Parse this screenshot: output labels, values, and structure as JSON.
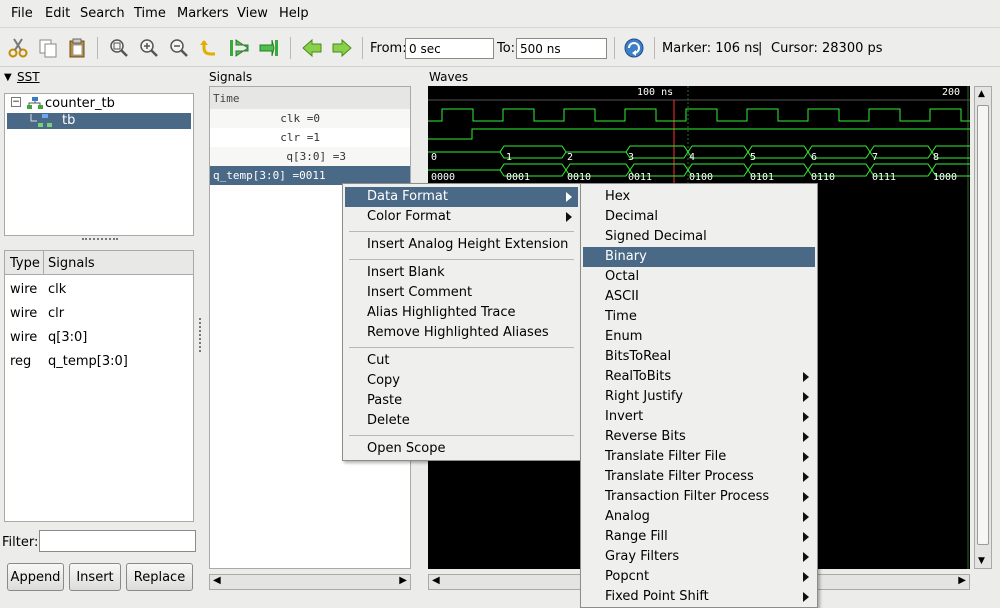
{
  "menu": [
    "File",
    "Edit",
    "Search",
    "Time",
    "Markers",
    "View",
    "Help"
  ],
  "toolbar": {
    "from_label": "From:",
    "from_value": "0 sec",
    "to_label": "To:",
    "to_value": "500 ns",
    "marker_text": "Marker: 106 ns",
    "separator": "|",
    "cursor_text": "Cursor: 28300 ps"
  },
  "sst": {
    "title": "SST",
    "tree": [
      "counter_tb",
      "tb"
    ],
    "columns": [
      "Type",
      "Signals"
    ],
    "rows": [
      {
        "type": "wire",
        "name": "clk"
      },
      {
        "type": "wire",
        "name": "clr"
      },
      {
        "type": "wire",
        "name": "q[3:0]"
      },
      {
        "type": "reg",
        "name": "q_temp[3:0]"
      }
    ],
    "filter_label": "Filter:",
    "filter_value": "",
    "buttons": [
      "Append",
      "Insert",
      "Replace"
    ]
  },
  "signals": {
    "title": "Signals",
    "header": "Time",
    "rows": [
      "clk =0",
      "clr =1",
      "q[3:0] =3",
      "q_temp[3:0] =0011"
    ]
  },
  "waves": {
    "title": "Waves",
    "ruler": [
      "100 ns",
      "200"
    ],
    "q_values": [
      "0",
      "1",
      "2",
      "3",
      "4",
      "5",
      "6",
      "7",
      "8"
    ],
    "qtemp_values": [
      "0000",
      "0001",
      "0010",
      "0011",
      "0100",
      "0101",
      "0110",
      "0111",
      "1000"
    ]
  },
  "context_menu": {
    "items": [
      "Data Format",
      "Color Format",
      "Insert Analog Height Extension",
      "Insert Blank",
      "Insert Comment",
      "Alias Highlighted Trace",
      "Remove Highlighted Aliases",
      "Cut",
      "Copy",
      "Paste",
      "Delete",
      "Open Scope"
    ],
    "highlighted": "Data Format"
  },
  "submenu": {
    "items": [
      "Hex",
      "Decimal",
      "Signed Decimal",
      "Binary",
      "Octal",
      "ASCII",
      "Time",
      "Enum",
      "BitsToReal",
      "RealToBits",
      "Right Justify",
      "Invert",
      "Reverse Bits",
      "Translate Filter File",
      "Translate Filter Process",
      "Transaction Filter Process",
      "Analog",
      "Range Fill",
      "Gray Filters",
      "Popcnt",
      "Fixed Point Shift"
    ],
    "highlighted": "Binary"
  },
  "colors": {
    "highlight": "#4a6986",
    "wave": "#33ee33",
    "marker": "#ff3030"
  }
}
